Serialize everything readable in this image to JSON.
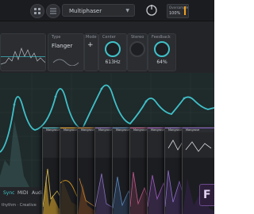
{
  "header": {
    "preset_name": "Multiphaser",
    "cpu_label": "Oversample",
    "cpu_value": "100%"
  },
  "type_panel": {
    "label": "Type",
    "value": "Flanger"
  },
  "mode_panel": {
    "label": "Mode"
  },
  "center_panel": {
    "label": "Center",
    "value": "613Hz"
  },
  "stereo_panel": {
    "label": "Stereo"
  },
  "feedback_panel": {
    "label": "Feedback",
    "value": "64%"
  },
  "bottom": {
    "tabs": [
      "Sync",
      "MIDI",
      "Audio"
    ],
    "plugin_line": "thythm · Creative"
  },
  "windows": [
    {
      "title": "Mangrove",
      "accent": "#3fc1c9"
    },
    {
      "title": "Mangrove 2",
      "accent": "#e0a020"
    },
    {
      "title": "Mangrove",
      "accent": "#c08030"
    },
    {
      "title": "Mangrove",
      "accent": "#8a70c0"
    },
    {
      "title": "Mangrove",
      "accent": "#5a8ac0"
    },
    {
      "title": "Mangrove",
      "accent": "#c05a8a"
    },
    {
      "title": "Mangrove",
      "accent": "#a05ac0"
    },
    {
      "title": "Mangrove",
      "accent": "#9070d0"
    },
    {
      "title": "Mangrove",
      "accent": "#7a5ac0"
    }
  ],
  "badge": {
    "letter": "F"
  },
  "colors": {
    "accent": "#3fc1c9",
    "background": "#232427",
    "window_border": "#444444"
  }
}
